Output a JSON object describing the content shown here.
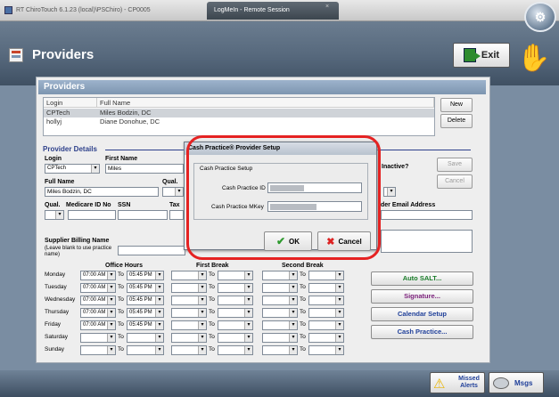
{
  "window": {
    "title": "RT ChiroTouch 6.1.23 (local)\\PSChiro) - CP0005",
    "remote_tab": "LogMeIn - Remote Session",
    "close_symbol": "×",
    "lmi_symbol": "⚙"
  },
  "header": {
    "title": "Providers",
    "exit_label": "Exit",
    "hand_symbol": "✋"
  },
  "providers": {
    "title": "Providers",
    "columns": [
      "Login",
      "Full Name"
    ],
    "rows": [
      {
        "login": "CPTech",
        "name": "Miles Bodzin, DC"
      },
      {
        "login": "hollyj",
        "name": "Diane Donohue, DC"
      }
    ],
    "new_label": "New",
    "delete_label": "Delete",
    "save_label": "Save",
    "cancel_label": "Cancel"
  },
  "details": {
    "section_title": "Provider Details",
    "login_label": "Login",
    "login_value": "CPTech",
    "first_name_label": "First Name",
    "first_name_value": "Miles",
    "inactive_label": "Inactive?",
    "full_name_label": "Full Name",
    "full_name_value": "Miles Bodzin, DC",
    "qual_label": "Qual.",
    "qual2_label": "Qual.",
    "medicare_label": "Medicare ID No",
    "ssn_label": "SSN",
    "tax_label": "Tax",
    "email_label": "der Email Address",
    "supplier_label": "Supplier Billing Name",
    "supplier_hint": "(Leave blank to use practice name)",
    "office_hours_label": "Office Hours",
    "first_break_label": "First Break",
    "second_break_label": "Second Break",
    "to_label": "To"
  },
  "schedule": [
    {
      "day": "Monday",
      "from": "07:00 AM",
      "to": "05:45 PM"
    },
    {
      "day": "Tuesday",
      "from": "07:00 AM",
      "to": "05:45 PM"
    },
    {
      "day": "Wednesday",
      "from": "07:00 AM",
      "to": "05:45 PM"
    },
    {
      "day": "Thursday",
      "from": "07:00 AM",
      "to": "05:45 PM"
    },
    {
      "day": "Friday",
      "from": "07:00 AM",
      "to": "05:45 PM"
    },
    {
      "day": "Saturday",
      "from": "",
      "to": ""
    },
    {
      "day": "Sunday",
      "from": "",
      "to": ""
    }
  ],
  "side_buttons": [
    {
      "label": "Auto SALT...",
      "color": "#1a7d2a"
    },
    {
      "label": "Signature...",
      "color": "#7a1f7a"
    },
    {
      "label": "Calendar Setup",
      "color": "#1f3f99"
    },
    {
      "label": "Cash Practice...",
      "color": "#1f3f99"
    }
  ],
  "dialog": {
    "title": "Cash Practice® Provider Setup",
    "group_label": "Cash Practice Setup",
    "id_label": "Cash Practice ID",
    "mkey_label": "Cash Practice MKey",
    "ok_label": "OK",
    "cancel_label": "Cancel",
    "ok_symbol": "✔",
    "cancel_symbol": "✖"
  },
  "footer": {
    "missed_label": "Missed Alerts",
    "msgs_label": "Msgs",
    "warning_symbol": "⚠"
  },
  "colors": {
    "highlight_ring": "#e52222",
    "header_blue": "#56687c",
    "section_blue": "#2c3f8a"
  }
}
